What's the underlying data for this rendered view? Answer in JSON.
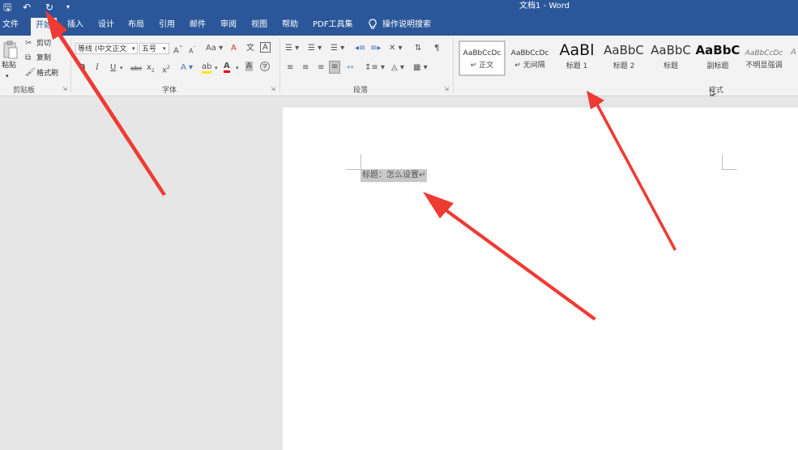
{
  "window": {
    "title": "文档1  -  Word"
  },
  "quick_access": {
    "save": "🖫",
    "undo": "↶",
    "redo": "↻",
    "more": "▾"
  },
  "tabs": [
    {
      "label": "文件"
    },
    {
      "label": "开始"
    },
    {
      "label": "插入"
    },
    {
      "label": "设计"
    },
    {
      "label": "布局"
    },
    {
      "label": "引用"
    },
    {
      "label": "邮件"
    },
    {
      "label": "审阅"
    },
    {
      "label": "视图"
    },
    {
      "label": "帮助"
    },
    {
      "label": "PDF工具集"
    }
  ],
  "tell_me": "操作说明搜索",
  "clipboard": {
    "paste": "粘贴",
    "cut": "剪切",
    "copy": "复制",
    "format_painter": "格式刷",
    "label": "剪贴板"
  },
  "font": {
    "name": "等线 (中文正文",
    "size": "五号",
    "label": "字体"
  },
  "paragraph": {
    "label": "段落"
  },
  "styles": {
    "label": "样式",
    "items": [
      {
        "preview": "AaBbCcDc",
        "name": "↵ 正文"
      },
      {
        "preview": "AaBbCcDc",
        "name": "↵ 无间隔"
      },
      {
        "preview": "AaBl",
        "name": "标题 1"
      },
      {
        "preview": "AaBbC",
        "name": "标题 2"
      },
      {
        "preview": "AaBbC",
        "name": "标题"
      },
      {
        "preview": "AaBbC",
        "name": "副标题"
      },
      {
        "preview": "AaBbCcDc",
        "name": "不明显强调"
      }
    ]
  },
  "document": {
    "paragraph": "标题：怎么设置↵"
  },
  "colors": {
    "accent": "#2b579a",
    "arrow": "#ee3b33"
  }
}
